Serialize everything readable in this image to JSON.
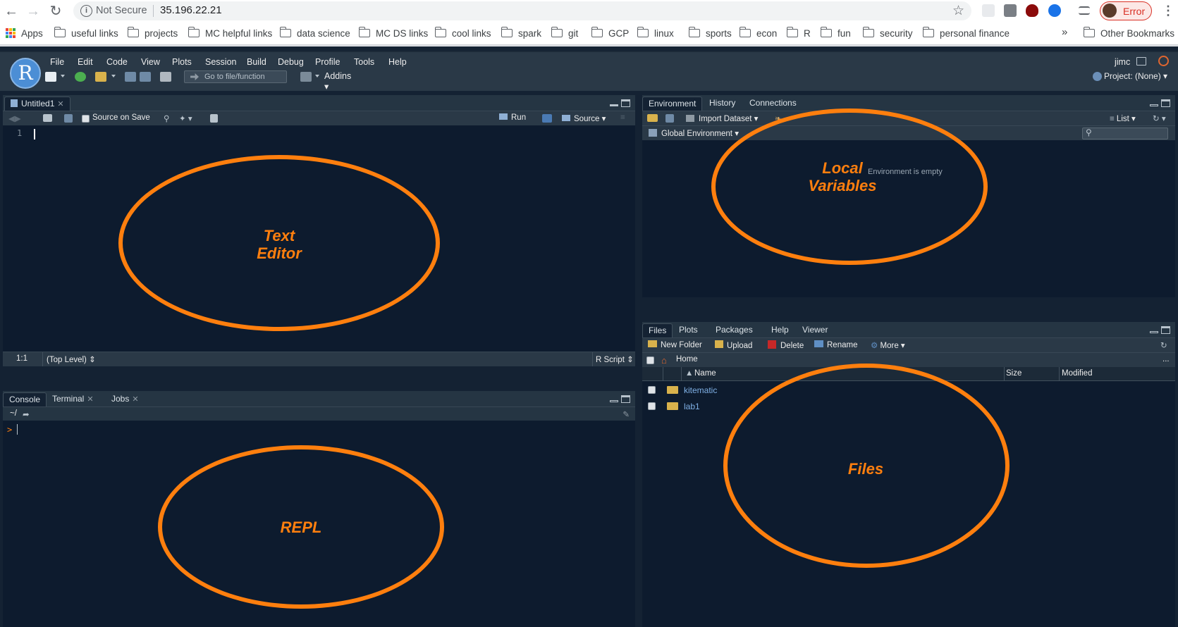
{
  "browser": {
    "security": "Not Secure",
    "host": "35.196.22.21",
    "profile_label": "Error",
    "bookmarks": [
      "Apps",
      "useful links",
      "projects",
      "MC helpful links",
      "data science",
      "MC DS links",
      "cool links",
      "spark",
      "git",
      "GCP",
      "linux",
      "sports",
      "econ",
      "R",
      "fun",
      "security",
      "personal finance"
    ],
    "more": "»",
    "other_bookmarks": "Other Bookmarks"
  },
  "rstudio": {
    "menu": [
      "File",
      "Edit",
      "Code",
      "View",
      "Plots",
      "Session",
      "Build",
      "Debug",
      "Profile",
      "Tools",
      "Help"
    ],
    "logo": "R",
    "user": "jimc",
    "goto_placeholder": "Go to file/function",
    "addins": "Addins",
    "project": "Project: (None)"
  },
  "editor": {
    "tab": "Untitled1",
    "source_on_save": "Source on Save",
    "run": "Run",
    "source": "Source",
    "line_number": "1",
    "position": "1:1",
    "scope": "(Top Level)",
    "file_type": "R Script"
  },
  "console": {
    "tabs": [
      "Console",
      "Terminal",
      "Jobs"
    ],
    "path": "~/",
    "prompt": ">"
  },
  "environment": {
    "tabs": [
      "Environment",
      "History",
      "Connections"
    ],
    "import_dataset": "Import Dataset",
    "view_mode": "List",
    "scope": "Global Environment",
    "empty_message": "Environment is empty"
  },
  "files": {
    "tabs": [
      "Files",
      "Plots",
      "Packages",
      "Help",
      "Viewer"
    ],
    "actions": [
      "New Folder",
      "Upload",
      "Delete",
      "Rename",
      "More"
    ],
    "breadcrumb": "Home",
    "columns": [
      "Name",
      "Size",
      "Modified"
    ],
    "rows": [
      {
        "name": "kitematic"
      },
      {
        "name": "lab1"
      }
    ]
  },
  "annotations": {
    "text_editor": [
      "Text",
      "Editor"
    ],
    "local_variables": [
      "Local",
      "Variables"
    ],
    "repl": "REPL",
    "files": "Files"
  },
  "colors": {
    "annotation": "#ff7f0e",
    "pane_bg": "#0d1b2e",
    "toolbar_bg": "#2a3947"
  }
}
